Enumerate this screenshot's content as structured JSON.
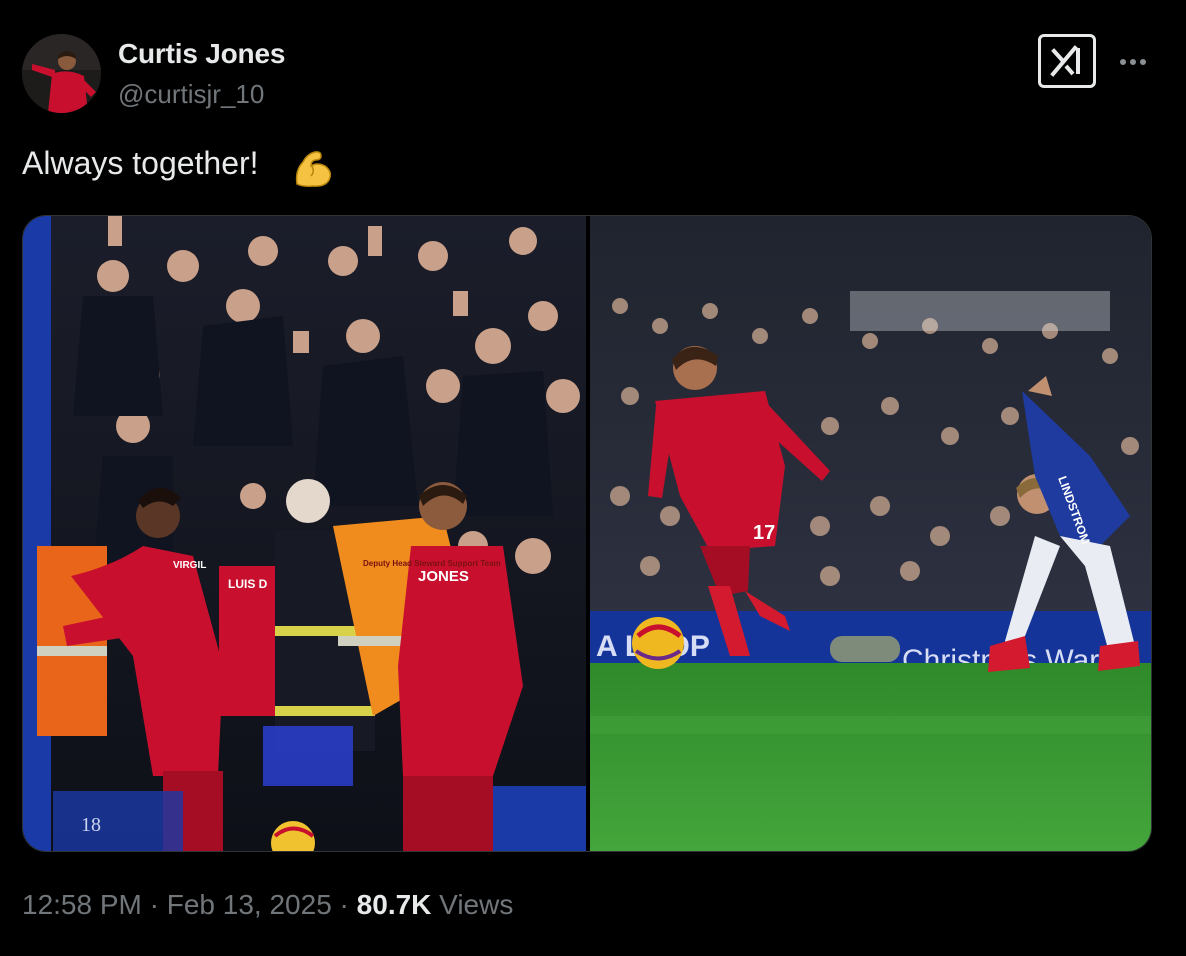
{
  "author": {
    "display_name": "Curtis Jones",
    "handle": "@curtisjr_10"
  },
  "tweet": {
    "text": "Always together!",
    "emoji": "flexed-biceps"
  },
  "media": {
    "left_photo": {
      "jersey_names": [
        "JONES",
        "LUIS D",
        "VIRGIL"
      ],
      "vest_text": "Deputy Head Steward Support Team",
      "board_text": "18"
    },
    "right_photo": {
      "jersey_name": "LINDSTROM",
      "jersey_number": "17",
      "board_text": "Christmas Ward",
      "board_left_text": "A LOOP"
    }
  },
  "meta": {
    "time": "12:58 PM",
    "separator": " · ",
    "date": "Feb 13, 2025",
    "views_count": "80.7K",
    "views_label": " Views"
  },
  "colors": {
    "background": "#000000",
    "primary_text": "#e7e9ea",
    "secondary_text": "#71767b",
    "liverpool_red": "#c8102e",
    "everton_blue": "#1f3ba0",
    "pitch_green": "#3f9b36"
  },
  "icons": {
    "grok": "grok-icon",
    "more": "more-dots-icon"
  }
}
